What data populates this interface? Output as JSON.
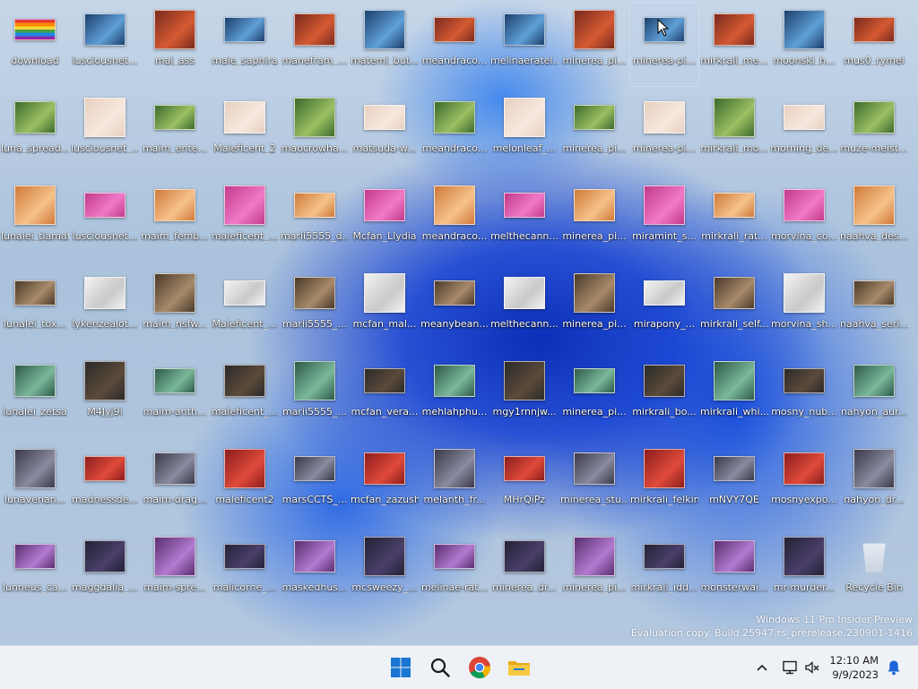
{
  "desktop": {
    "columns": [
      [
        "download",
        "luna_spread...",
        "lunalei_tiamat",
        "lunalei_tox...",
        "lunalei_zetsa",
        "lunavenan...",
        "lunneus_ca..."
      ],
      [
        "lusciousnet...",
        "lusciousnet_...",
        "lusciousnet...",
        "lykenzealot...",
        "M4Jyj9i",
        "madnessde...",
        "maggdalia_..."
      ],
      [
        "mai_ass",
        "maim_ente...",
        "maim_femb...",
        "maim_nsfw...",
        "maim-anth...",
        "maim-drag...",
        "maim-spre..."
      ],
      [
        "male_saphira",
        "Maleficent_2",
        "maleficent_...",
        "Maleficent_...",
        "maleficent_...",
        "maleficent2",
        "malicorne_..."
      ],
      [
        "manefram_...",
        "maocrowha...",
        "marii5555_d...",
        "marii5555_...",
        "marii5555_...",
        "marsCCTS_...",
        "maskedhus..."
      ],
      [
        "matemi_but...",
        "matsuda-w...",
        "Mcfan_Llydia",
        "mcfan_mal...",
        "mcfan_vera...",
        "mcfan_zazush",
        "mcsweezy_..."
      ],
      [
        "meandraco...",
        "meandraco...",
        "meandraco...",
        "meanybean...",
        "mehlahphu...",
        "melanth_fr...",
        "melinae-rat..."
      ],
      [
        "melinaeratel...",
        "melonleaf_...",
        "melthecann...",
        "melthecann...",
        "mgy1rnnjw...",
        "MHrQiPz",
        "minerea_dr..."
      ],
      [
        "minerea_pi...",
        "minerea_pi...",
        "minerea_pi...",
        "minerea_pi...",
        "minerea_pi...",
        "minerea_stu...",
        "minerea_pi..."
      ],
      [
        "minerea-pi...",
        "minerea-pi...",
        "miramint_s...",
        "mirapony_...",
        "mirkrali_bo...",
        "mirkrali_felkin",
        "mirkrali_idd..."
      ],
      [
        "mirkrali_me...",
        "mirkrali_mo...",
        "mirkrali_rat...",
        "mirkrali_self...",
        "mirkrali_whi...",
        "mNVY7QE",
        "monsterwai..."
      ],
      [
        "moonski_h...",
        "morning_de...",
        "morvina_co...",
        "morvina_sh...",
        "mosny_nub...",
        "mosnyexpo...",
        "mr-murder..."
      ],
      [
        "mus0_rymel",
        "muze-meist...",
        "naahva_des...",
        "naahva_seri...",
        "nahyon_aur...",
        "nahyon_dr...",
        "Recycle Bin"
      ]
    ],
    "selected": "minerea-pi...",
    "watermark_line1": "Windows 11 Pro Insider Preview",
    "watermark_line2": "Evaluation copy. Build 25947.rs_prerelease.230901-1416"
  },
  "taskbar": {
    "apps": [
      "start-icon",
      "search-icon",
      "chrome-icon",
      "file-explorer-icon"
    ],
    "clock_time": "12:10 AM",
    "clock_date": "9/9/2023",
    "tray_icons": [
      "chevron-up-icon",
      "network-icon",
      "volume-muted-icon",
      "notification-bell-icon"
    ]
  },
  "colors": {
    "taskbar_bg": "#eef1f6",
    "start_blue": "#1976d2",
    "bell_blue": "#1a64d8"
  }
}
